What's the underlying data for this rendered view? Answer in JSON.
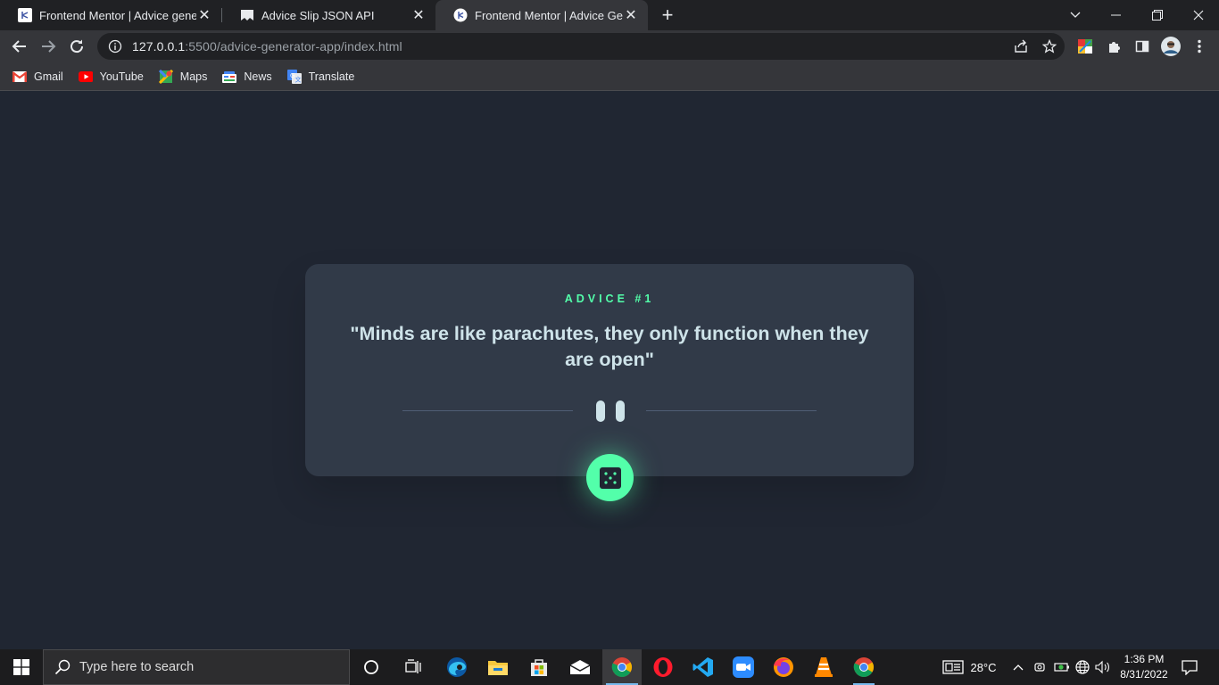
{
  "browser": {
    "tabs": [
      {
        "title": "Frontend Mentor | Advice genera",
        "favicon": "frontend-mentor-icon",
        "active": false
      },
      {
        "title": "Advice Slip JSON API",
        "favicon": "advice-slip-icon",
        "active": false
      },
      {
        "title": "Frontend Mentor | Advice Genera",
        "favicon": "frontend-mentor-icon",
        "active": true
      }
    ],
    "url_host": "127.0.0.1",
    "url_rest": ":5500/advice-generator-app/index.html",
    "bookmarks": [
      {
        "label": "Gmail",
        "icon": "gmail-icon"
      },
      {
        "label": "YouTube",
        "icon": "youtube-icon"
      },
      {
        "label": "Maps",
        "icon": "maps-icon"
      },
      {
        "label": "News",
        "icon": "news-icon"
      },
      {
        "label": "Translate",
        "icon": "translate-icon"
      }
    ]
  },
  "page": {
    "advice_id": "ADVICE #1",
    "advice_text": "\"Minds are like parachutes, they only function when they are open\"",
    "accent_color": "#53ffaa",
    "card_color": "#313a48",
    "background_color": "#202632"
  },
  "taskbar": {
    "search_placeholder": "Type here to search",
    "weather": "28°C",
    "time": "1:36 PM",
    "date": "8/31/2022",
    "apps": [
      "cortana-icon",
      "task-view-icon",
      "edge-icon",
      "file-explorer-icon",
      "store-icon",
      "mail-icon",
      "chrome-icon",
      "opera-icon",
      "vscode-icon",
      "zoom-icon",
      "firefox-icon",
      "vlc-icon",
      "chrome-icon"
    ]
  }
}
